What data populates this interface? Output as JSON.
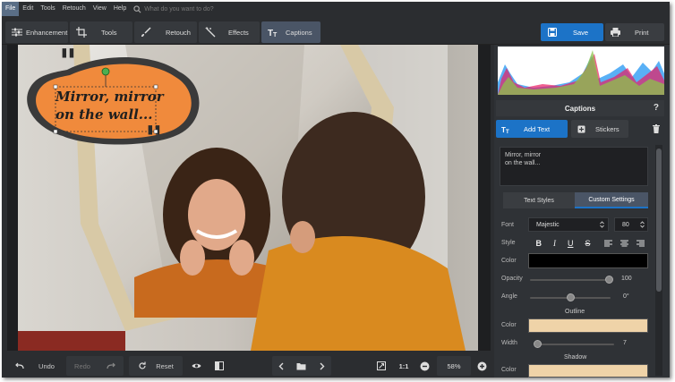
{
  "menu": {
    "items": [
      "File",
      "Edit",
      "Tools",
      "Retouch",
      "View",
      "Help"
    ],
    "search_placeholder": "What do you want to do?"
  },
  "toolbar": {
    "tabs": [
      "Enhancement",
      "Tools",
      "Retouch",
      "Effects",
      "Captions"
    ],
    "active_tab": "Captions",
    "save_label": "Save",
    "print_label": "Print"
  },
  "canvas": {
    "caption_text_line1": "Mirror, mirror",
    "caption_text_line2": "on the wall...",
    "bubble_color": "#f08a3c"
  },
  "bottom": {
    "undo_label": "Undo",
    "redo_label": "Redo",
    "reset_label": "Reset",
    "one_to_one": "1:1",
    "zoom_value": "58%"
  },
  "panel": {
    "title": "Captions",
    "help": "?",
    "add_text_label": "Add Text",
    "stickers_label": "Stickers",
    "text_content_line1": "Mirror, mirror",
    "text_content_line2": "on the wall...",
    "subtab_text_styles": "Text Styles",
    "subtab_custom_settings": "Custom Settings",
    "font_label": "Font",
    "font_value": "Majestic",
    "font_size": "80",
    "style_label": "Style",
    "style_buttons": [
      "B",
      "I",
      "U",
      "S"
    ],
    "color_label": "Color",
    "text_color": "#000000",
    "opacity_label": "Opacity",
    "opacity_value": "100",
    "angle_label": "Angle",
    "angle_value": "0°",
    "outline_heading": "Outline",
    "outline_color_label": "Color",
    "outline_color": "#efd3a8",
    "width_label": "Width",
    "width_value": "7",
    "shadow_heading": "Shadow",
    "shadow_color_label": "Color",
    "shadow_color": "#efd3a8"
  }
}
